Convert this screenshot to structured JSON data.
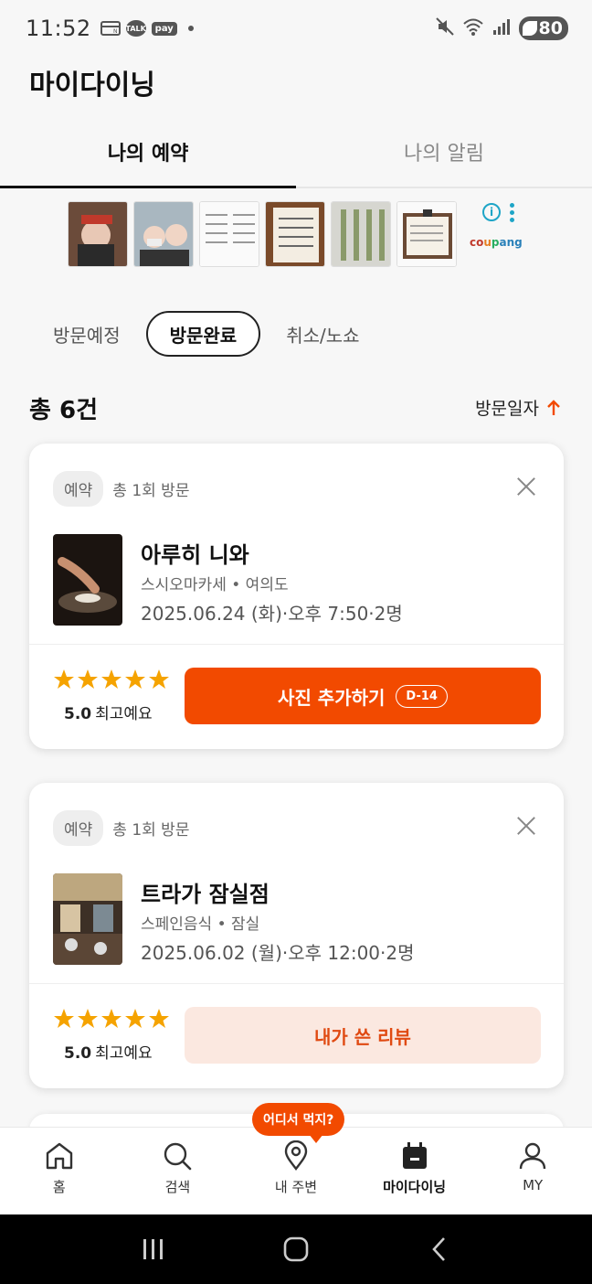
{
  "status": {
    "time": "11:52",
    "talk_label": "TALK",
    "pay_label": "pay",
    "battery": "80"
  },
  "page_title": "마이다이닝",
  "tabs": [
    {
      "label": "나의 예약",
      "active": true
    },
    {
      "label": "나의 알림",
      "active": false
    }
  ],
  "ad": {
    "brand": [
      "co",
      "u",
      "p",
      "ang"
    ],
    "info_icon": "info-icon",
    "more_icon": "more-vertical-icon"
  },
  "filters": [
    {
      "label": "방문예정",
      "active": false
    },
    {
      "label": "방문완료",
      "active": true
    },
    {
      "label": "취소/노쇼",
      "active": false
    }
  ],
  "count_label": "총 6건",
  "sort_label": "방문일자",
  "reservations": [
    {
      "badge": "예약",
      "visits": "총 1회 방문",
      "name": "아루히 니와",
      "category": "스시오마카세 • 여의도",
      "datetime": "2025.06.24 (화)·오후 7:50·2명",
      "stars": 5,
      "rating": "5.0",
      "rating_text": "최고예요",
      "button_label": "사진 추가하기",
      "dday": "D-14"
    },
    {
      "badge": "예약",
      "visits": "총 1회 방문",
      "name": "트라가 잠실점",
      "category": "스페인음식 • 잠실",
      "datetime": "2025.06.02 (월)·오후 12:00·2명",
      "stars": 5,
      "rating": "5.0",
      "rating_text": "최고예요",
      "button_label": "내가 쓴 리뷰"
    }
  ],
  "tooltip": "어디서 먹지?",
  "nav": [
    {
      "label": "홈",
      "icon": "home-icon"
    },
    {
      "label": "검색",
      "icon": "search-icon"
    },
    {
      "label": "내 주변",
      "icon": "location-pin-icon"
    },
    {
      "label": "마이다이닝",
      "icon": "calendar-icon",
      "active": true
    },
    {
      "label": "MY",
      "icon": "person-icon"
    }
  ],
  "colors": {
    "accent": "#f24a00",
    "star": "#f5a300",
    "light_button": "#fbe8e0"
  }
}
